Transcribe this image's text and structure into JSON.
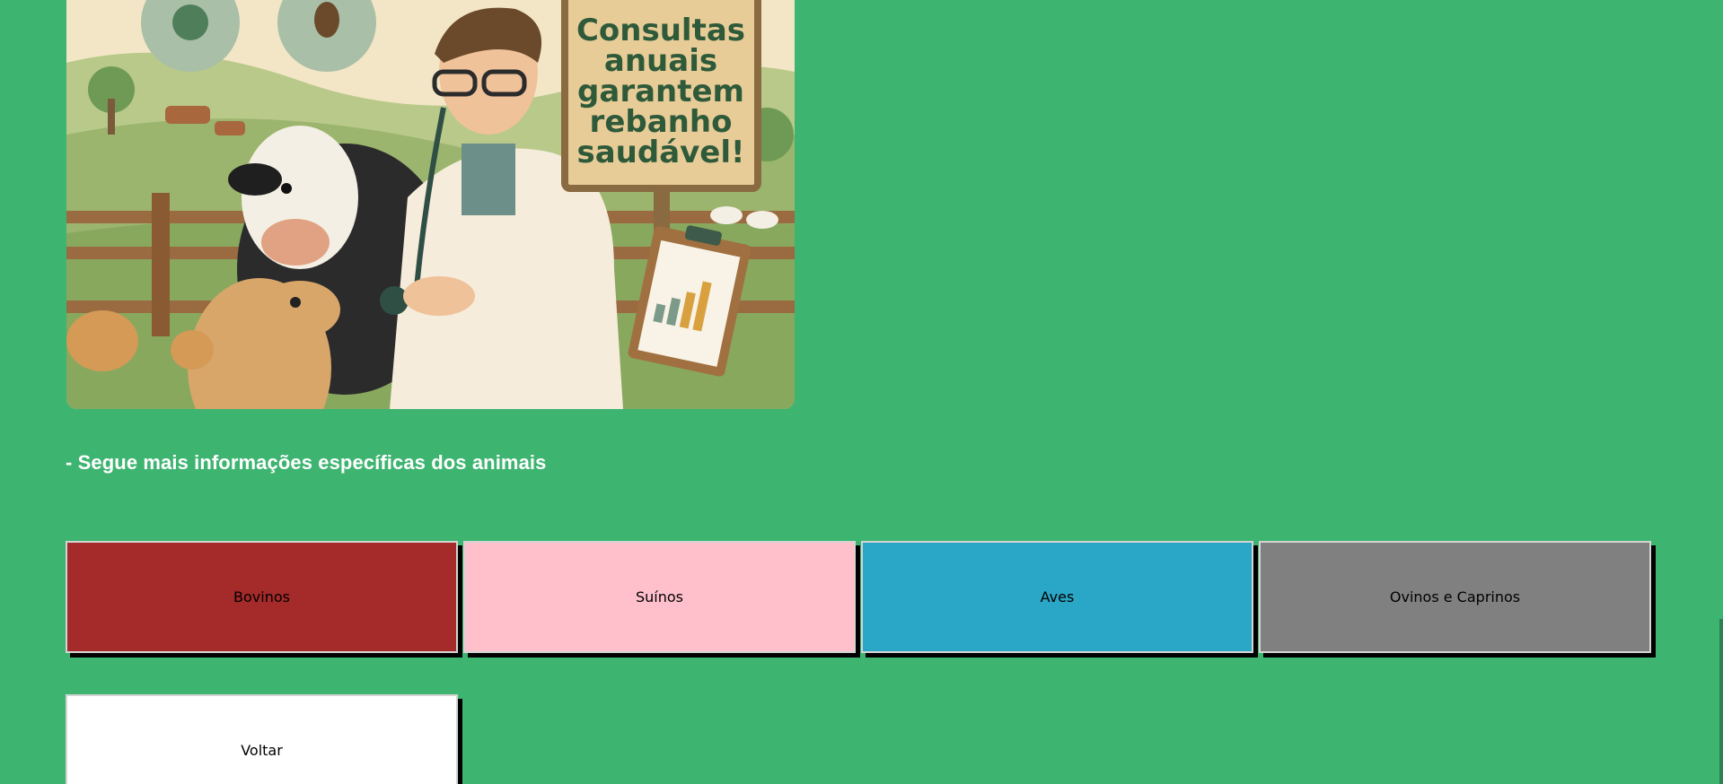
{
  "illustration": {
    "sign_lines": [
      "Consultas",
      "anuais",
      "garantem",
      "rebanho",
      "saudável!"
    ]
  },
  "section": {
    "heading": "- Segue mais informações específicas dos animais"
  },
  "buttons": {
    "bovinos": "Bovinos",
    "suinos": "Suínos",
    "aves": "Aves",
    "ovinos": "Ovinos e Caprinos",
    "voltar": "Voltar"
  },
  "colors": {
    "background": "#3eb471",
    "bovinos": "#a52a2a",
    "suinos": "#ffc0cb",
    "aves": "#2aa6c6",
    "ovinos": "#808080",
    "voltar": "#ffffff"
  }
}
